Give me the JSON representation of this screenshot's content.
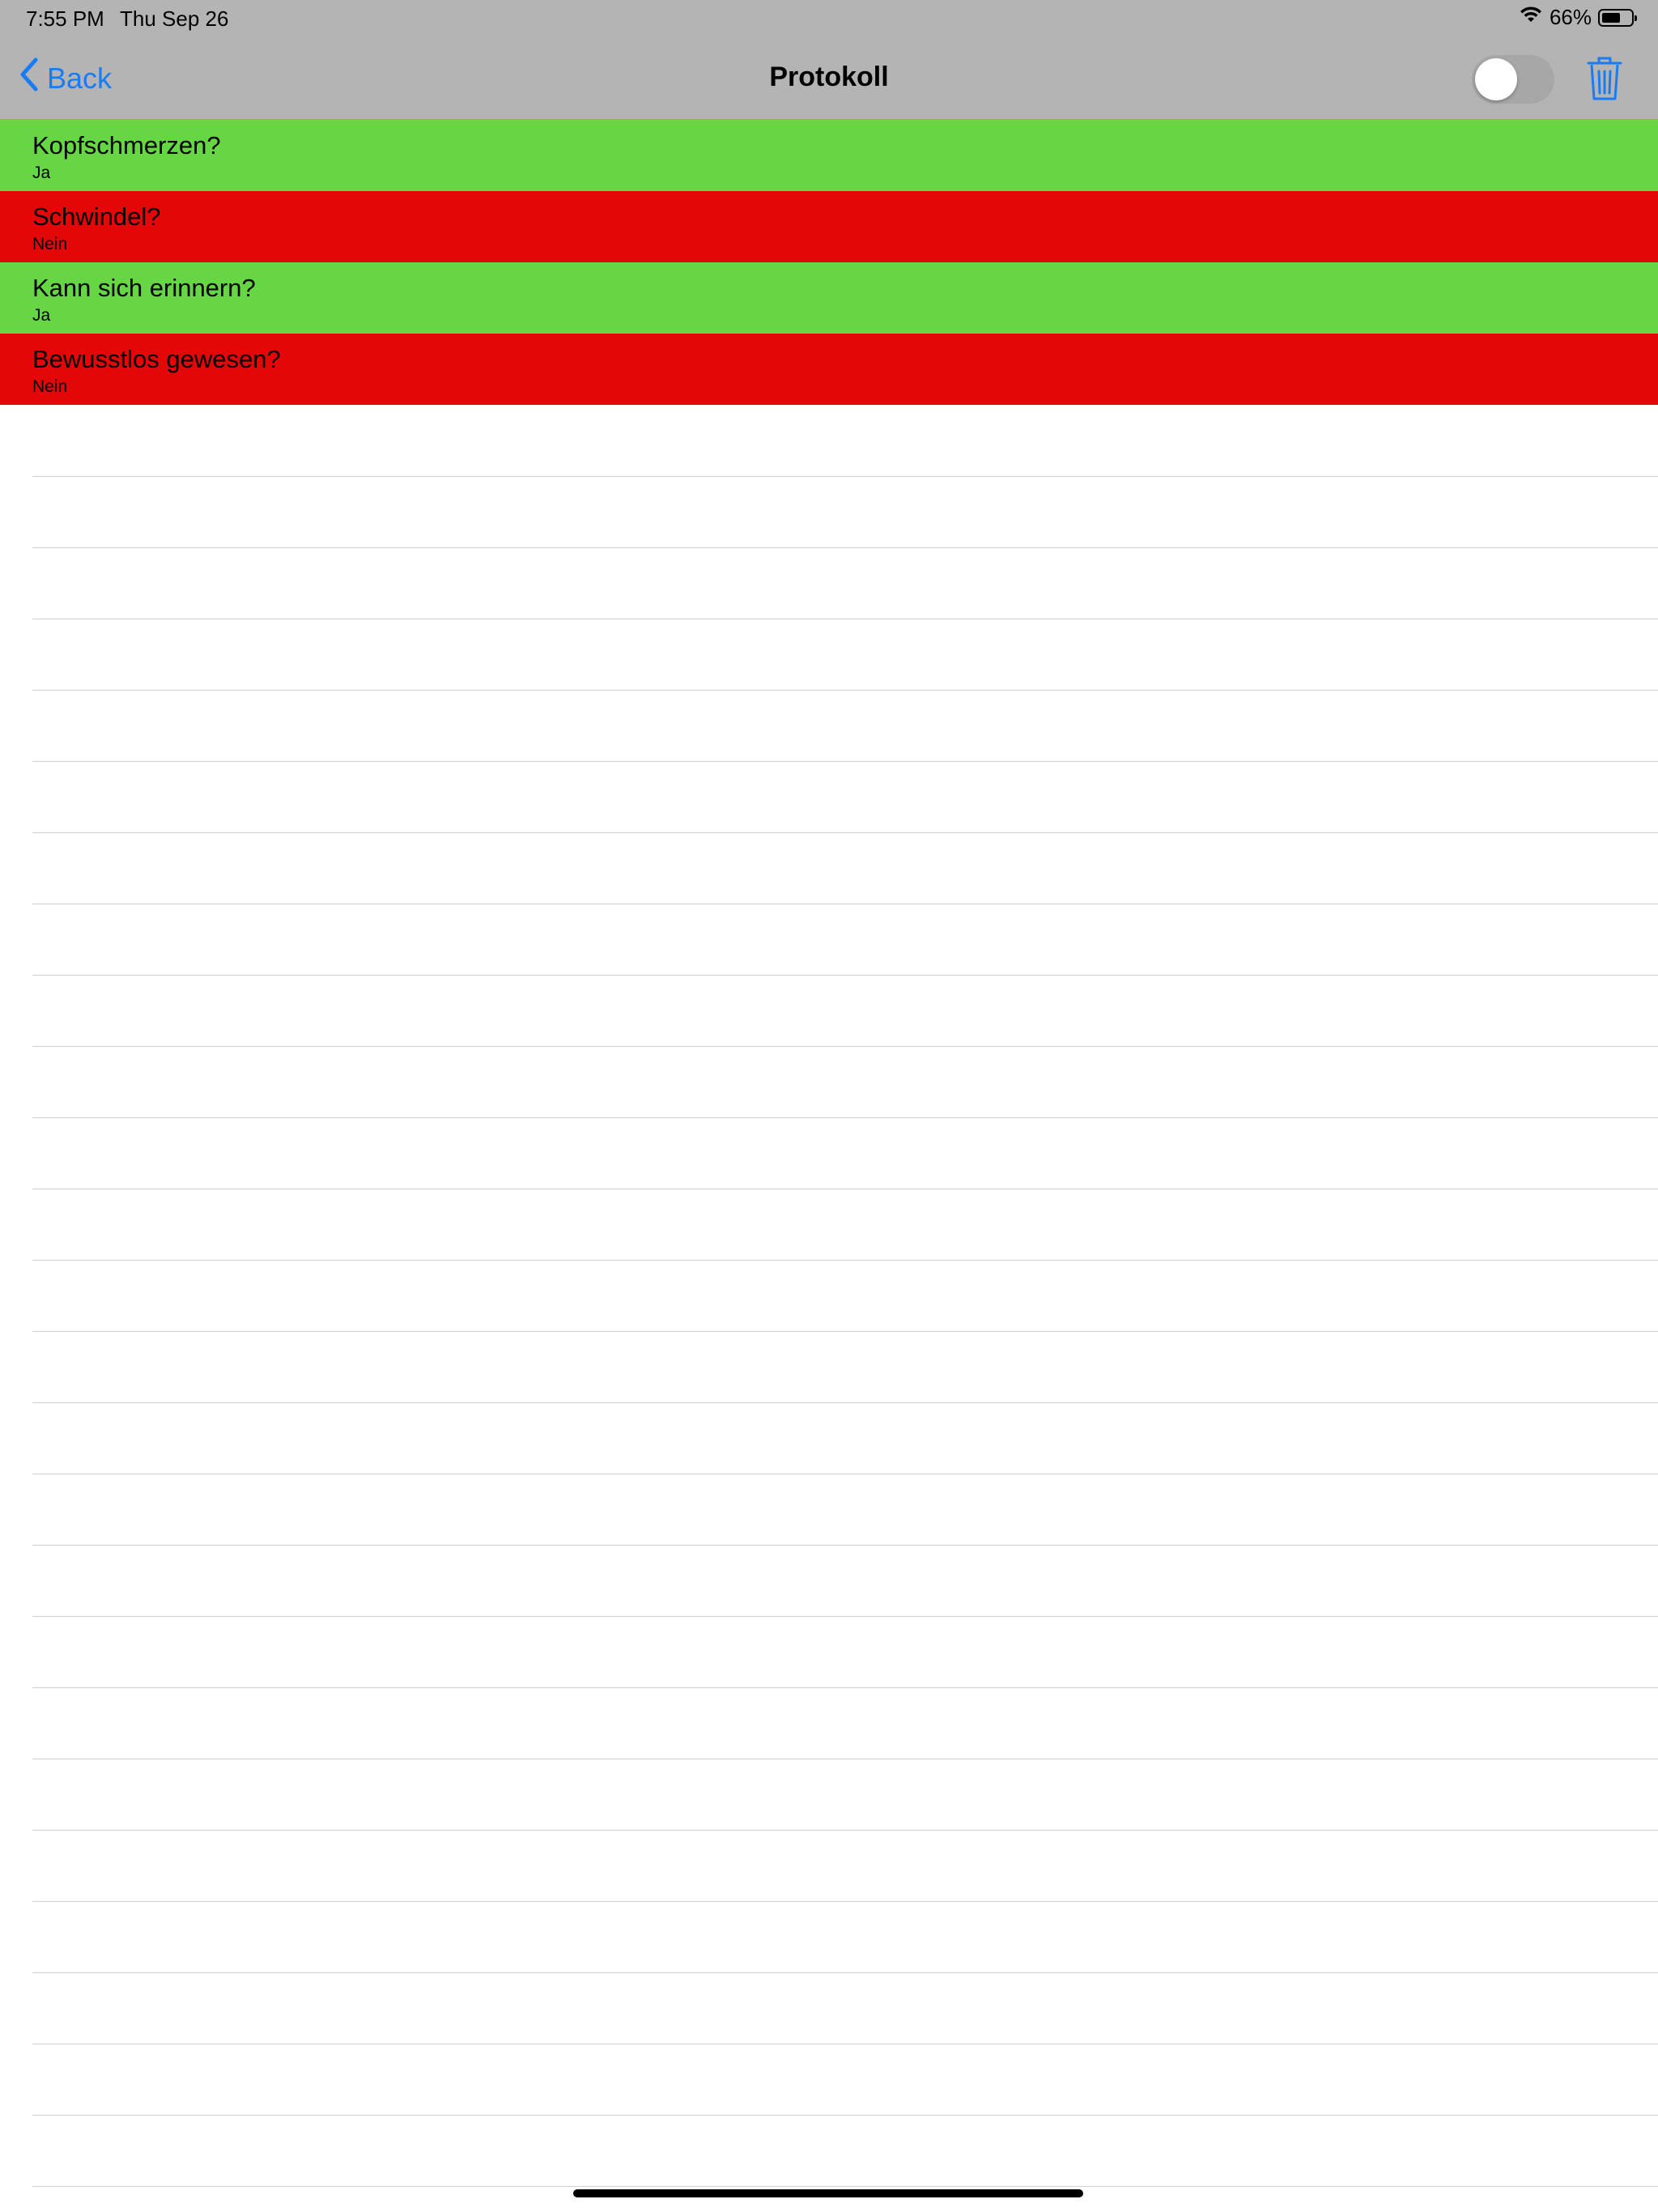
{
  "status_bar": {
    "time": "7:55 PM",
    "date": "Thu Sep 26",
    "battery_percent": "66%",
    "battery_level": 0.66,
    "wifi_icon": "wifi-icon"
  },
  "nav": {
    "back_label": "Back",
    "title": "Protokoll",
    "toggle_on": false,
    "trash_icon": "trash-icon",
    "accent_color": "#1a7cf5"
  },
  "entries": [
    {
      "question": "Kopfschmerzen?",
      "answer": "Ja",
      "color": "#66d644"
    },
    {
      "question": "Schwindel?",
      "answer": "Nein",
      "color": "#e30707"
    },
    {
      "question": "Kann sich erinnern?",
      "answer": "Ja",
      "color": "#66d644"
    },
    {
      "question": "Bewusstlos gewesen?",
      "answer": "Nein",
      "color": "#e30707"
    }
  ]
}
